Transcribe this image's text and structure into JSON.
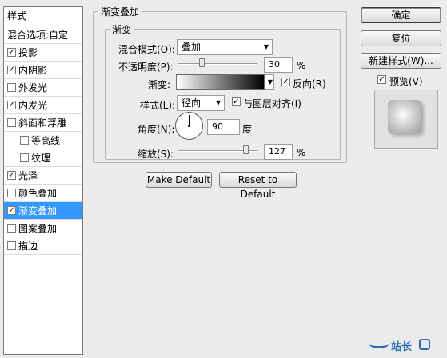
{
  "left_panel": {
    "header": "样式",
    "blend_options": "混合选项:自定",
    "items": [
      {
        "label": "投影",
        "checked": true,
        "indent": false,
        "selected": false
      },
      {
        "label": "内阴影",
        "checked": true,
        "indent": false,
        "selected": false
      },
      {
        "label": "外发光",
        "checked": false,
        "indent": false,
        "selected": false
      },
      {
        "label": "内发光",
        "checked": true,
        "indent": false,
        "selected": false
      },
      {
        "label": "斜面和浮雕",
        "checked": false,
        "indent": false,
        "selected": false
      },
      {
        "label": "等高线",
        "checked": false,
        "indent": true,
        "selected": false
      },
      {
        "label": "纹理",
        "checked": false,
        "indent": true,
        "selected": false
      },
      {
        "label": "光泽",
        "checked": true,
        "indent": false,
        "selected": false
      },
      {
        "label": "颜色叠加",
        "checked": false,
        "indent": false,
        "selected": false
      },
      {
        "label": "渐变叠加",
        "checked": true,
        "indent": false,
        "selected": true
      },
      {
        "label": "图案叠加",
        "checked": false,
        "indent": false,
        "selected": false
      },
      {
        "label": "描边",
        "checked": false,
        "indent": false,
        "selected": false
      }
    ]
  },
  "main": {
    "section_title": "渐变叠加",
    "group_title": "渐变",
    "blend_mode_label": "混合模式(O):",
    "blend_mode_value": "叠加",
    "opacity_label": "不透明度(P):",
    "opacity_value": "30",
    "opacity_fraction": 0.3,
    "percent": "%",
    "gradient_label": "渐变:",
    "reverse_label": "反向(R)",
    "reverse_checked": true,
    "style_label": "样式(L):",
    "style_value": "径向",
    "align_label": "与图层对齐(I)",
    "align_checked": true,
    "angle_label": "角度(N):",
    "angle_value": "90",
    "angle_unit": "度",
    "scale_label": "缩放(S):",
    "scale_value": "127",
    "scale_fraction": 0.85,
    "make_default": "Make Default",
    "reset_default": "Reset to Default"
  },
  "right": {
    "ok": "确定",
    "reset": "复位",
    "new_style": "新建样式(W)...",
    "preview_label": "预览(V)",
    "preview_checked": true
  },
  "watermark": "站长",
  "colors": {
    "selection": "#3399ff",
    "background": "#ececec"
  }
}
